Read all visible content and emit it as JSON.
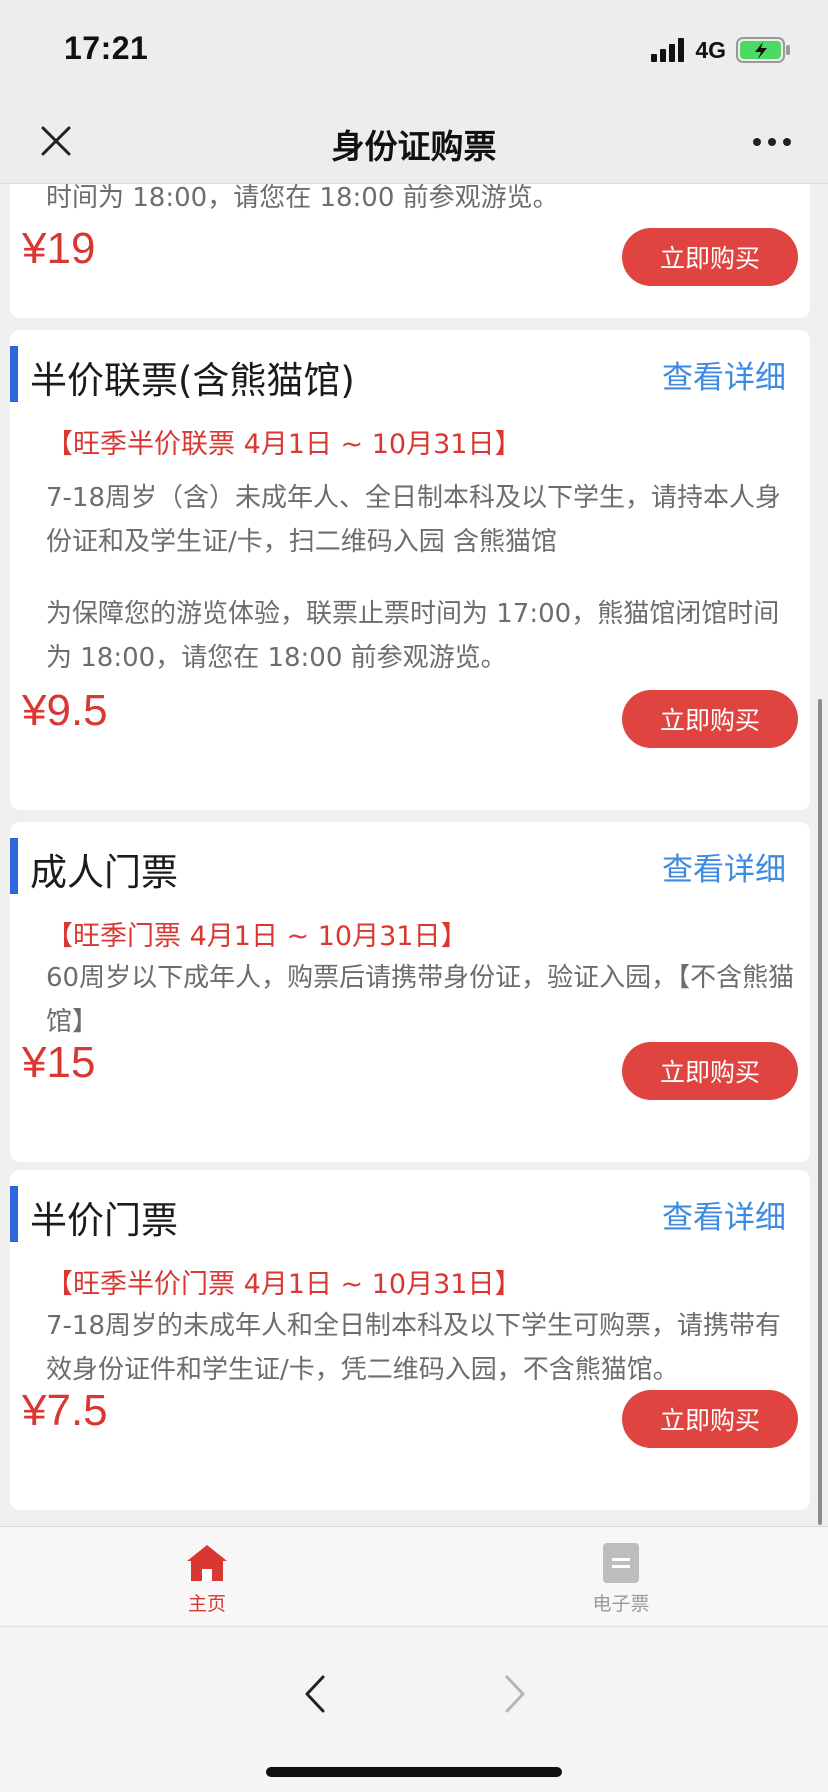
{
  "status_bar": {
    "time": "17:21",
    "network": "4G"
  },
  "nav": {
    "title": "身份证购票",
    "close_icon": "close-icon",
    "more_icon": "more-dots-icon"
  },
  "colors": {
    "accent_red": "#e04440",
    "link_blue": "#3d8be0",
    "title_bar_blue": "#2f66dd"
  },
  "cards": [
    {
      "desc_tail": "时间为 18:00，请您在 18:00 前参观游览。",
      "price": "¥19",
      "buy_label": "立即购买"
    },
    {
      "title": "半价联票(含熊猫馆)",
      "detail_label": "查看详细",
      "season": "【旺季半价联票 4月1日 ~ 10月31日】",
      "desc": "7-18周岁（含）未成年人、全日制本科及以下学生，请持本人身份证和及学生证/卡，扫二维码入园 含熊猫馆",
      "notice": "为保障您的游览体验，联票止票时间为 17:00，熊猫馆闭馆时间为 18:00，请您在 18:00 前参观游览。",
      "price": "¥9.5",
      "buy_label": "立即购买"
    },
    {
      "title": "成人门票",
      "detail_label": "查看详细",
      "season": "【旺季门票 4月1日 ~ 10月31日】",
      "desc": "60周岁以下成年人，购票后请携带身份证，验证入园，【不含熊猫馆】",
      "price": "¥15",
      "buy_label": "立即购买"
    },
    {
      "title": "半价门票",
      "detail_label": "查看详细",
      "season": "【旺季半价门票 4月1日 ~ 10月31日】",
      "desc": "7-18周岁的未成年人和全日制本科及以下学生可购票，请携带有效身份证件和学生证/卡，凭二维码入园，不含熊猫馆。",
      "price": "¥7.5",
      "buy_label": "立即购买"
    }
  ],
  "tab_bar": {
    "home_label": "主页",
    "eticket_label": "电子票",
    "active": "主页"
  }
}
